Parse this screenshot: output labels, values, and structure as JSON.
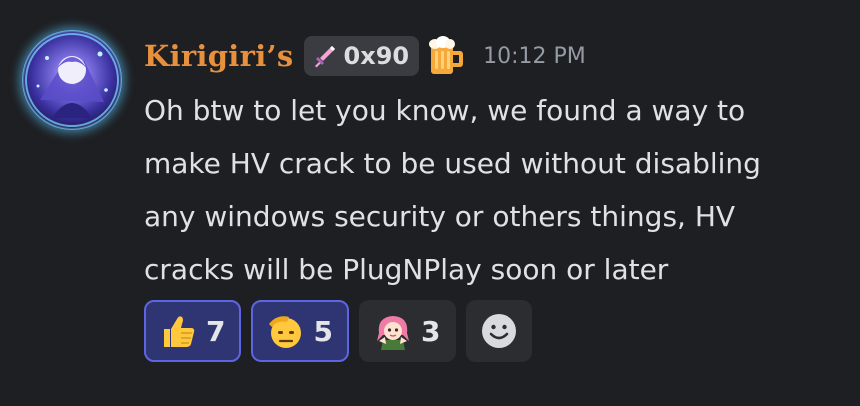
{
  "message": {
    "author": "Kirigiri’s",
    "guild_tag": {
      "icon": "sword-icon",
      "text": "0x90"
    },
    "role_icon": "beer-mug-icon",
    "timestamp": "10:12 PM",
    "lines": [
      "Oh btw to let you know, we found a way to",
      "make HV crack to be used without disabling",
      "any windows security or others things, HV",
      "cracks will be PlugNPlay soon or later"
    ]
  },
  "reactions": [
    {
      "emoji": "thumbs-up-icon",
      "count": "7",
      "reacted_by_me": true
    },
    {
      "emoji": "saluting-face-icon",
      "count": "5",
      "reacted_by_me": true
    },
    {
      "emoji": "anime-girl-sticker-icon",
      "count": "3",
      "reacted_by_me": false
    }
  ],
  "add_reaction_icon": "smiley-add-reaction-icon",
  "colors": {
    "background": "#1e1f22",
    "username": "#e7903d",
    "text": "#dfe1e5",
    "timestamp": "#949ba4",
    "reaction_active_bg": "#2f3572",
    "reaction_active_border": "#5d66e0",
    "reaction_bg": "#2b2d31"
  }
}
